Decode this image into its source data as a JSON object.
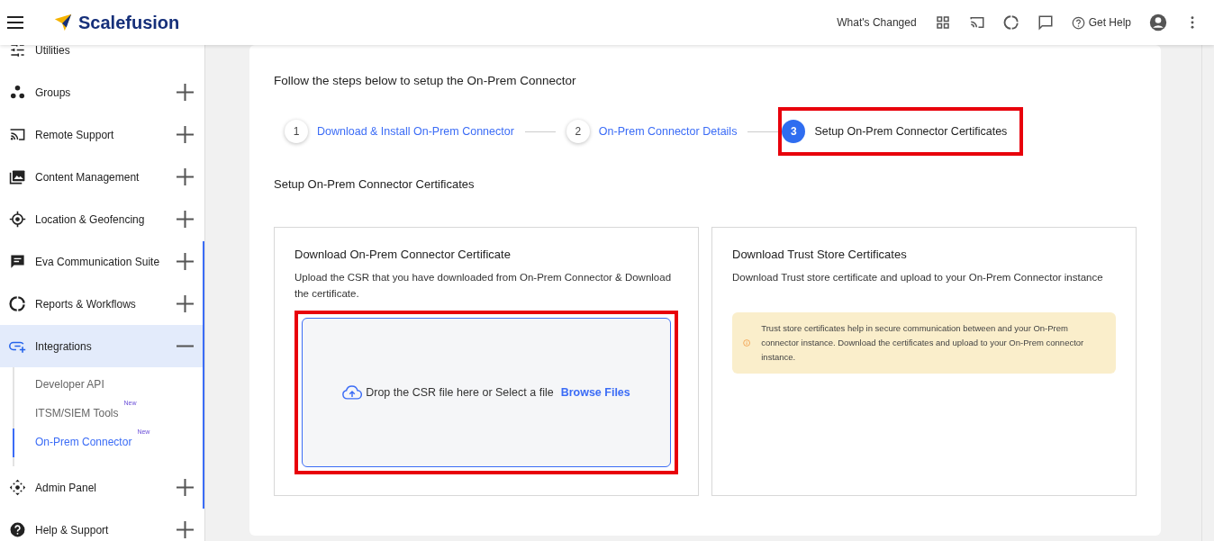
{
  "header": {
    "brand": "Scalefusion",
    "whats_changed": "What's Changed",
    "get_help": "Get Help"
  },
  "sidebar": {
    "items": [
      {
        "kind": "utilities",
        "label": "Utilities",
        "selected": false
      },
      {
        "kind": "groups",
        "label": "Groups",
        "expanded": false,
        "selected": false
      },
      {
        "kind": "remote",
        "label": "Remote Support",
        "expanded": false,
        "selected": false
      },
      {
        "kind": "content",
        "label": "Content Management",
        "expanded": false,
        "selected": false
      },
      {
        "kind": "location",
        "label": "Location & Geofencing",
        "expanded": false,
        "selected": false
      },
      {
        "kind": "chat",
        "label": "Eva Communication Suite",
        "expanded": false,
        "selected": false
      },
      {
        "kind": "reports",
        "label": "Reports & Workflows",
        "expanded": false,
        "selected": false
      },
      {
        "kind": "integrations",
        "label": "Integrations",
        "expanded": true,
        "selected": true,
        "children": [
          {
            "label": "Developer API",
            "selected": false
          },
          {
            "label": "ITSM/SIEM Tools",
            "badge": "New",
            "selected": false
          },
          {
            "label": "On-Prem Connector",
            "badge": "New",
            "selected": true
          }
        ]
      },
      {
        "kind": "admin",
        "label": "Admin Panel",
        "expanded": false,
        "selected": false
      },
      {
        "kind": "help",
        "label": "Help & Support",
        "expanded": false,
        "selected": false
      }
    ]
  },
  "main": {
    "intro": "Follow the steps below to setup the On-Prem Connector",
    "steps": [
      {
        "number": "1",
        "label": "Download & Install On-Prem Connector",
        "selected": false,
        "outlined": false
      },
      {
        "number": "2",
        "label": "On-Prem Connector Details",
        "selected": false,
        "outlined": false
      },
      {
        "number": "3",
        "label": "Setup On-Prem Connector Certificates",
        "selected": true,
        "outlined": true
      }
    ],
    "section_title": "Setup On-Prem Connector Certificates",
    "cards": [
      {
        "kind": "upload",
        "title": "Download On-Prem Connector Certificate",
        "description": "Upload the CSR that you have downloaded from On-Prem Connector & Download the certificate.",
        "dropzone": {
          "text": "Drop the CSR file here or Select a file",
          "link": "Browse Files",
          "outlined": true
        }
      },
      {
        "kind": "info",
        "title": "Download Trust Store Certificates",
        "description": "Download Trust store certificate and upload to your On-Prem Connector instance",
        "note": "Trust store certificates help in secure communication between and your On-Prem connector instance. Download the certificates and upload to your On-Prem connector instance."
      }
    ]
  }
}
